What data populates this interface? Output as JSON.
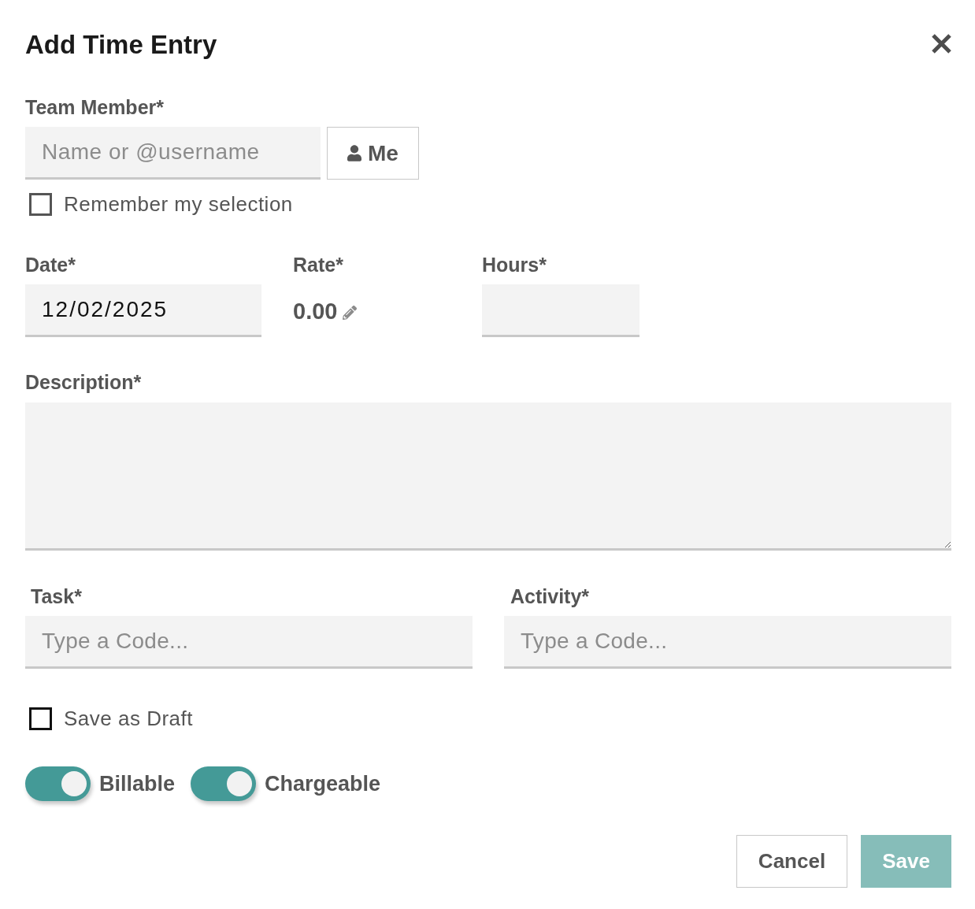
{
  "dialog": {
    "title": "Add Time Entry"
  },
  "team_member": {
    "label": "Team Member*",
    "placeholder": "Name or @username",
    "me_button": "Me"
  },
  "remember_selection": {
    "label": "Remember my selection",
    "checked": false
  },
  "date": {
    "label": "Date*",
    "value": "12/02/2025"
  },
  "rate": {
    "label": "Rate*",
    "value": "0.00"
  },
  "hours": {
    "label": "Hours*"
  },
  "description": {
    "label": "Description*"
  },
  "task": {
    "label": "Task*",
    "placeholder": "Type a Code..."
  },
  "activity": {
    "label": "Activity*",
    "placeholder": "Type a Code..."
  },
  "save_as_draft": {
    "label": "Save as Draft",
    "checked": false
  },
  "toggles": [
    {
      "label": "Billable",
      "on": true
    },
    {
      "label": "Chargeable",
      "on": true
    }
  ],
  "buttons": [
    {
      "label": "Cancel",
      "kind": "secondary",
      "disabled": false
    },
    {
      "label": "Save",
      "kind": "primary",
      "disabled": true
    }
  ]
}
